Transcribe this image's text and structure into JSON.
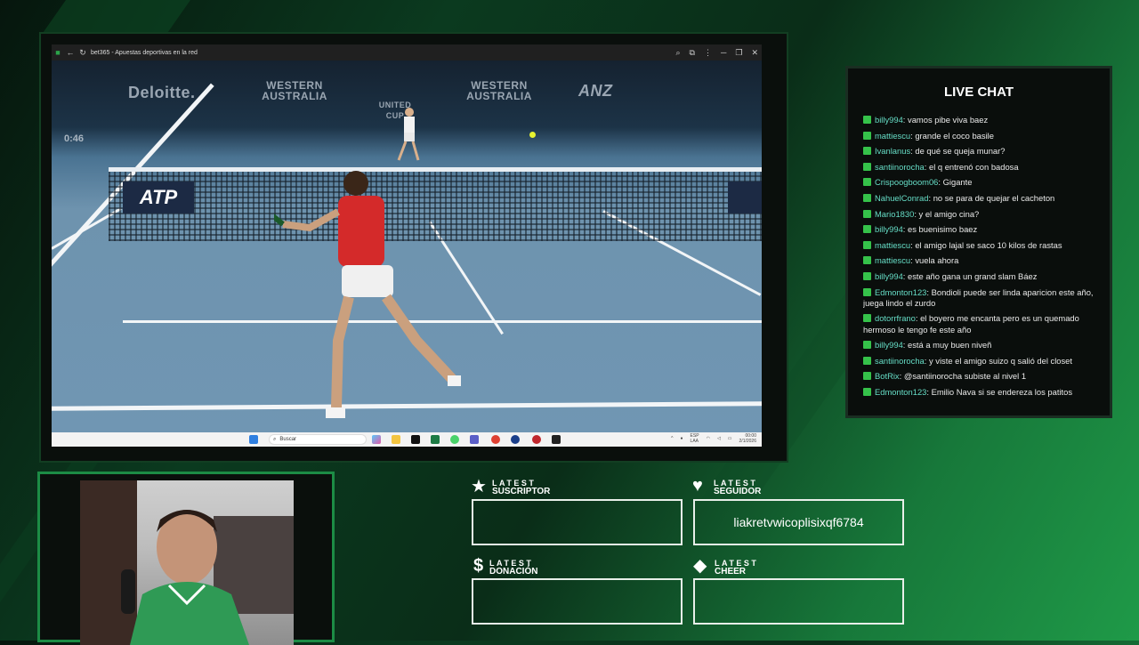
{
  "browser": {
    "tab_title": "bet365 - Apuestas deportivas en la red"
  },
  "video": {
    "sponsors": [
      "Deloitte.",
      "WESTERN AUSTRALIA",
      "UNITED CUP",
      "WESTERN AUSTRALIA",
      "ANZ"
    ],
    "net_board": "ATP",
    "clock": "0:46"
  },
  "taskbar": {
    "search_placeholder": "Buscar",
    "language": "ESP\nLAA",
    "time": "00:00",
    "date": "2/1/2026"
  },
  "chat": {
    "title": "LIVE CHAT",
    "messages": [
      {
        "user": "billy994",
        "text": "vamos pibe viva baez"
      },
      {
        "user": "mattiescu",
        "text": "grande el coco basile"
      },
      {
        "user": "Ivanlanus",
        "text": "de qué se queja munar?"
      },
      {
        "user": "santiinorocha",
        "text": "el q entrenó con badosa"
      },
      {
        "user": "Crispoogboom06",
        "text": "Gigante"
      },
      {
        "user": "NahuelConrad",
        "text": "no se para de quejar el cacheton"
      },
      {
        "user": "Mario1830",
        "text": "y el amigo cina?"
      },
      {
        "user": "billy994",
        "text": "es buenisimo baez"
      },
      {
        "user": "mattiescu",
        "text": "el amigo lajal se saco 10 kilos de rastas"
      },
      {
        "user": "mattiescu",
        "text": "vuela ahora"
      },
      {
        "user": "billy994",
        "text": "este año gana un grand slam Báez"
      },
      {
        "user": "Edmonton123",
        "text": "Bondioli puede ser linda aparicion este año, juega lindo el zurdo"
      },
      {
        "user": "dotorrfrano",
        "text": "el boyero me encanta pero es un quemado hermoso le tengo fe este año"
      },
      {
        "user": "billy994",
        "text": "está a muy buen niveñ"
      },
      {
        "user": "santiinorocha",
        "text": "y viste el amigo suizo q salió del closet"
      },
      {
        "user": "BotRix",
        "text": "@santiinorocha subiste al nivel 1"
      },
      {
        "user": "Edmonton123",
        "text": "Emilio Nava si se endereza los patitos"
      }
    ]
  },
  "alerts": {
    "suscriptor": {
      "l1": "LATEST",
      "l2": "SUSCRIPTOR",
      "value": ""
    },
    "seguidor": {
      "l1": "LATEST",
      "l2": "SEGUIDOR",
      "value": "liakretvwicoplisixqf6784"
    },
    "donacion": {
      "l1": "LATEST",
      "l2": "DONACIÓN",
      "value": ""
    },
    "cheer": {
      "l1": "LATEST",
      "l2": "CHEER",
      "value": ""
    }
  },
  "colors": {
    "chat_username": "#66ddc6",
    "chat_badge": "#35c24a",
    "frame_green": "#1c8c45"
  }
}
